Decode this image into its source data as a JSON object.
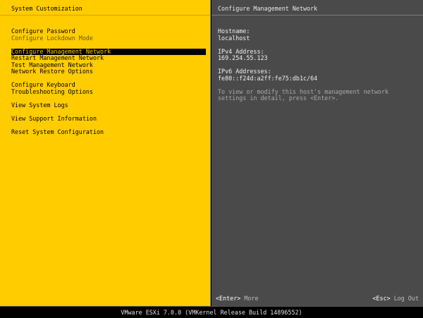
{
  "left": {
    "title": "System Customization",
    "groups": [
      [
        {
          "label": "Configure Password",
          "state": "normal"
        },
        {
          "label": "Configure Lockdown Mode",
          "state": "dim"
        }
      ],
      [
        {
          "label": "Configure Management Network",
          "state": "selected"
        },
        {
          "label": "Restart Management Network",
          "state": "normal"
        },
        {
          "label": "Test Management Network",
          "state": "normal"
        },
        {
          "label": "Network Restore Options",
          "state": "normal"
        }
      ],
      [
        {
          "label": "Configure Keyboard",
          "state": "normal"
        },
        {
          "label": "Troubleshooting Options",
          "state": "normal"
        }
      ],
      [
        {
          "label": "View System Logs",
          "state": "normal"
        }
      ],
      [
        {
          "label": "View Support Information",
          "state": "normal"
        }
      ],
      [
        {
          "label": "Reset System Configuration",
          "state": "normal"
        }
      ]
    ]
  },
  "right": {
    "title": "Configure Management Network",
    "hostname_label": "Hostname:",
    "hostname_value": "localhost",
    "ipv4_label": "IPv4 Address:",
    "ipv4_value": "169.254.55.123",
    "ipv6_label": "IPv6 Addresses:",
    "ipv6_value": "fe80::f24d:a2ff:fe75:db1c/64",
    "hint": "To view or modify this host's management network settings in detail, press <Enter>."
  },
  "footer": {
    "enter_key": "<Enter>",
    "enter_action": "More",
    "esc_key": "<Esc>",
    "esc_action": "Log Out"
  },
  "status_bar": {
    "text": "VMware ESXi 7.0.0 (VMKernel Release Build 14896552)"
  },
  "colors": {
    "left_bg": "#ffcc00",
    "right_bg": "#4a4a4a",
    "selected_bg": "#000000",
    "selected_fg": "#ffcc00"
  }
}
